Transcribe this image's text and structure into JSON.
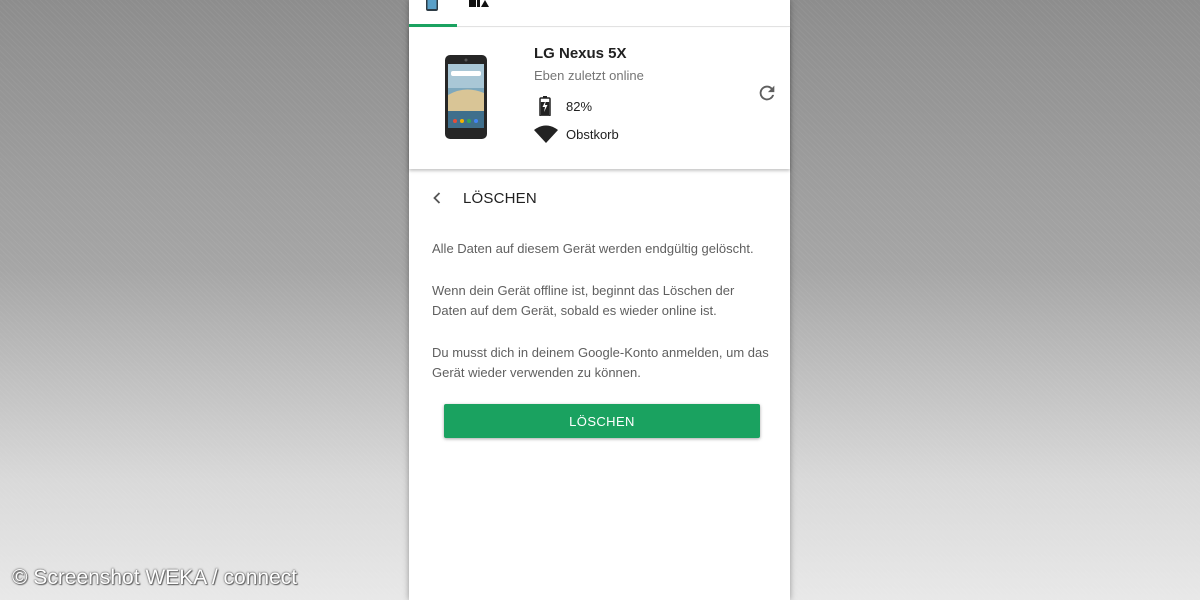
{
  "device": {
    "name": "LG Nexus 5X",
    "status": "Eben zuletzt online",
    "battery": "82%",
    "network": "Obstkorb"
  },
  "erase": {
    "title": "LÖSCHEN",
    "paragraphs": [
      "Alle Daten auf diesem Gerät werden endgültig gelöscht.",
      "Wenn dein Gerät offline ist, beginnt das Löschen der Daten auf dem Gerät, sobald es wieder online ist.",
      "Du musst dich in deinem Google-Konto anmelden, um das Gerät wieder verwenden zu können."
    ],
    "button_label": "LÖSCHEN"
  },
  "colors": {
    "accent": "#1aa260"
  },
  "icons": {
    "tab_device": "phone-icon",
    "tab_sound": "play-sound-icon",
    "battery": "battery-charging-icon",
    "wifi": "wifi-icon",
    "refresh": "refresh-icon",
    "back": "chevron-left-icon"
  },
  "watermark": "© Screenshot WEKA / connect"
}
